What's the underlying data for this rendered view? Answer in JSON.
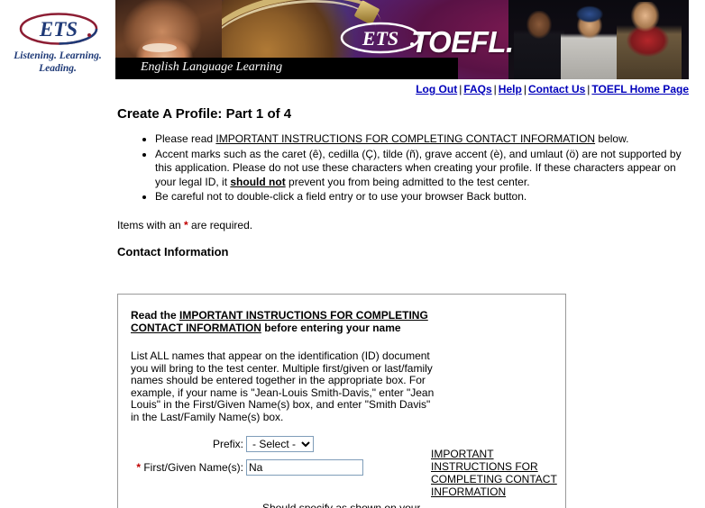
{
  "logo": {
    "mark_text": "ETS",
    "tagline": "Listening. Learning. Leading."
  },
  "banner": {
    "ets_mark": "ETS",
    "product": "TOEFL.",
    "strip_text": "English Language Learning"
  },
  "nav": {
    "items": [
      {
        "label": "Log Out"
      },
      {
        "label": "FAQs"
      },
      {
        "label": "Help"
      },
      {
        "label": "Contact Us"
      },
      {
        "label": "TOEFL Home Page"
      }
    ],
    "separator": "|"
  },
  "page": {
    "title": "Create A Profile: Part 1 of 4",
    "bullets": {
      "b1_pre": "Please read ",
      "b1_link": "IMPORTANT INSTRUCTIONS FOR COMPLETING CONTACT INFORMATION",
      "b1_post": " below.",
      "b2_pre": "Accent marks such as the caret (ê), cedilla (Ç), tilde (ñ), grave accent (è), and umlaut (ö) are not supported by this application. Please do not use these characters when creating your profile. If these characters appear on your legal ID, it ",
      "b2_bold": "should not",
      "b2_post": " prevent you from being admitted to the test center.",
      "b3": "Be careful not to double-click a field entry or to use your browser Back button."
    },
    "required_note_pre": "Items with an ",
    "required_star": "*",
    "required_note_post": " are required.",
    "section_heading": "Contact Information"
  },
  "contact_box": {
    "read_pre": "Read the ",
    "read_link": "IMPORTANT INSTRUCTIONS FOR COMPLETING CONTACT INFORMATION",
    "read_post": " before entering your name",
    "names_help": "List ALL names that appear on the identification (ID) document you will bring to the test center. Multiple first/given or last/family names should be entered together in the appropriate box. For example, if your name is \"Jean-Louis Smith-Davis,\" enter \"Jean Louis\" in the First/Given Name(s) box, and enter \"Smith Davis\" in the Last/Family Name(s) box.",
    "prefix_label": "Prefix:",
    "prefix_selected": "- Select -",
    "prefix_options": [
      "- Select -"
    ],
    "first_name_star": "*",
    "first_name_label": " First/Given Name(s):",
    "first_name_value": "Na",
    "first_name_placeholder": "",
    "cut_off_line": "Should specify as shown on your"
  },
  "side_links": {
    "link_text": "IMPORTANT INSTRUCTIONS FOR COMPLETING CONTACT INFORMATION"
  },
  "colors": {
    "link_blue": "#0000bb",
    "required_red": "#c00000",
    "ets_navy": "#1f3a77",
    "ets_maroon": "#8c1d33",
    "box_border": "#9a9a9a",
    "field_border": "#7f9db9"
  }
}
